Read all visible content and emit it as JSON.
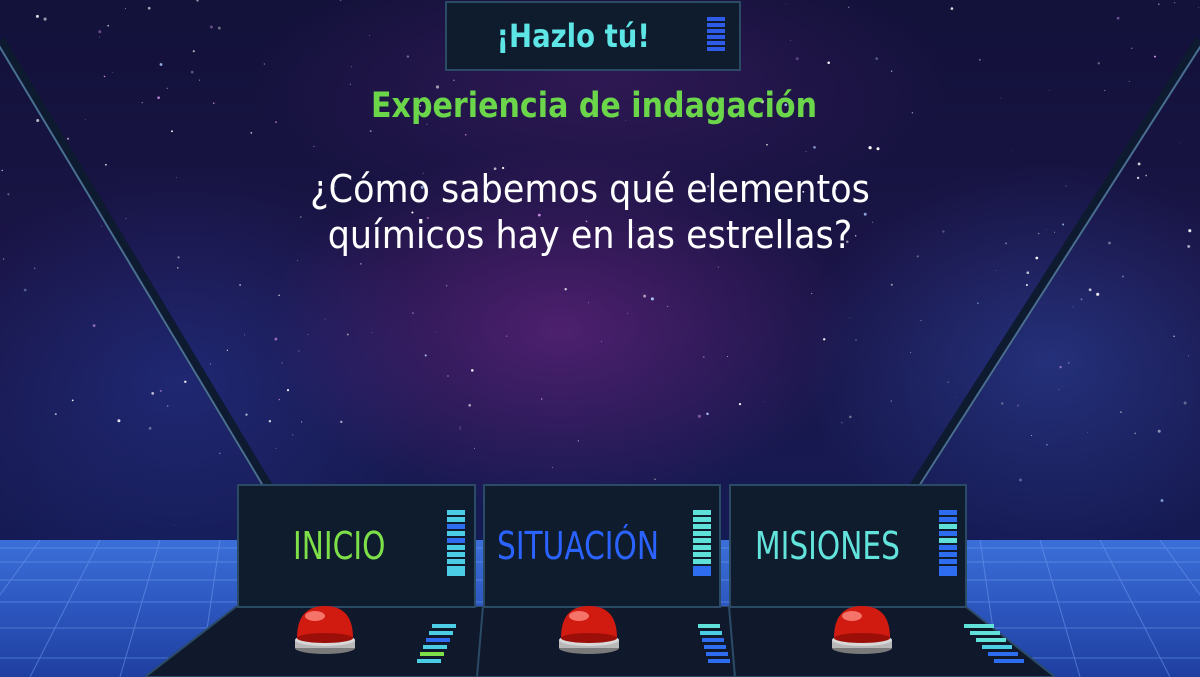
{
  "header": {
    "title": "¡Hazlo tú!",
    "subtitle": "Experiencia de indagación",
    "question_line1": "¿Cómo sabemos qué elementos",
    "question_line2": "químicos hay en las estrellas?"
  },
  "menu": {
    "items": [
      {
        "label": "INICIO",
        "color": "#7ee048"
      },
      {
        "label": "SITUACIÓN",
        "color": "#2a63ff"
      },
      {
        "label": "MISIONES",
        "color": "#62e4dc"
      }
    ]
  },
  "colors": {
    "panel_bg": "#0f1c2e",
    "panel_border": "#2b4a66",
    "title_text": "#5ee6e6",
    "subtitle_text": "#6cd64a",
    "button_red": "#d11a10"
  }
}
